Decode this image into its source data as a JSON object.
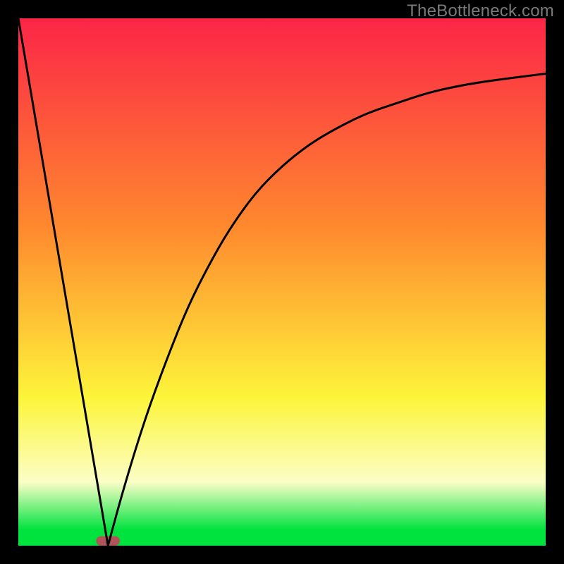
{
  "watermark": "TheBottleneck.com",
  "colors": {
    "black": "#000000",
    "line": "#000000",
    "marker": "#b1545a",
    "grad_top": "#fb2547",
    "grad_mid1": "#ff8a2e",
    "grad_mid2": "#fdf53a",
    "grad_pale": "#fbfec7",
    "grad_green": "#00e33e"
  },
  "chart_data": {
    "type": "line",
    "title": "",
    "xlabel": "",
    "ylabel": "",
    "x_range": [
      0,
      1
    ],
    "y_range": [
      0,
      1
    ],
    "grid": false,
    "legend": null,
    "optimum_x": 0.17,
    "marker": {
      "x": 0.17,
      "width": 0.045,
      "height": 0.018,
      "radius": 0.009
    },
    "series": [
      {
        "name": "left-descent",
        "type": "line",
        "x": [
          0.0,
          0.17
        ],
        "y": [
          1.0,
          0.0
        ]
      },
      {
        "name": "right-curve",
        "type": "curve",
        "x": [
          0.17,
          0.2,
          0.24,
          0.28,
          0.32,
          0.36,
          0.4,
          0.45,
          0.5,
          0.55,
          0.6,
          0.66,
          0.72,
          0.78,
          0.85,
          0.92,
          1.0
        ],
        "y": [
          0.0,
          0.11,
          0.24,
          0.35,
          0.45,
          0.53,
          0.6,
          0.67,
          0.72,
          0.76,
          0.79,
          0.82,
          0.84,
          0.86,
          0.875,
          0.885,
          0.895
        ]
      }
    ]
  }
}
